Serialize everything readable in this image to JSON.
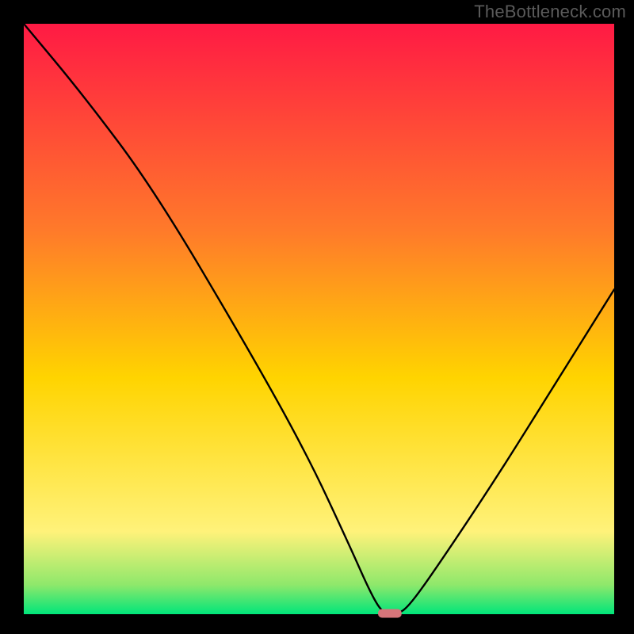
{
  "watermark": "TheBottleneck.com",
  "colors": {
    "background_black": "#000000",
    "gradient_top": "#ff1a44",
    "gradient_mid": "#ffd400",
    "gradient_low": "#fff27a",
    "gradient_bottom": "#00e57a",
    "curve": "#000000",
    "marker": "#d6757a",
    "watermark_text": "#5a5a5a"
  },
  "plot": {
    "inner_x": 30,
    "inner_y": 30,
    "inner_w": 745,
    "inner_h": 745,
    "x_range": [
      0,
      100
    ],
    "y_range": [
      0,
      100
    ]
  },
  "chart_data": {
    "type": "line",
    "title": "",
    "xlabel": "",
    "ylabel": "",
    "x": [
      0,
      10,
      22,
      38,
      48,
      55,
      59,
      61,
      63,
      65,
      70,
      80,
      90,
      100
    ],
    "values": [
      100,
      88,
      72,
      45,
      27,
      12,
      3,
      0,
      0,
      1,
      8,
      23,
      39,
      55
    ],
    "minimum_marker": {
      "x": 62,
      "y": 0,
      "width_pct": 4
    },
    "x_range": [
      0,
      100
    ],
    "y_range": [
      0,
      100
    ],
    "gradient_stops": [
      {
        "offset": 0.0,
        "color": "#ff1a44"
      },
      {
        "offset": 0.35,
        "color": "#ff7a2a"
      },
      {
        "offset": 0.6,
        "color": "#ffd400"
      },
      {
        "offset": 0.86,
        "color": "#fff27a"
      },
      {
        "offset": 0.95,
        "color": "#8fe86b"
      },
      {
        "offset": 1.0,
        "color": "#00e57a"
      }
    ]
  }
}
